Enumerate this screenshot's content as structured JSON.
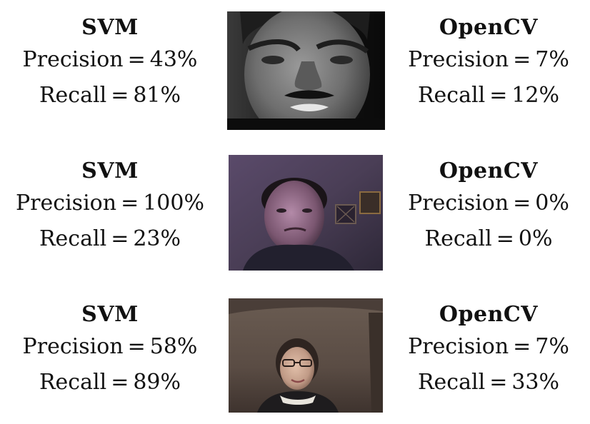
{
  "rows": [
    {
      "svm": {
        "title": "SVM",
        "precision_label": "Precision",
        "precision": "43%",
        "recall_label": "Recall",
        "recall": "81%"
      },
      "opencv": {
        "title": "OpenCV",
        "precision_label": "Precision",
        "precision": "7%",
        "recall_label": "Recall",
        "recall": "12%"
      },
      "image": "grayscale-portrait-man-in-suit"
    },
    {
      "svm": {
        "title": "SVM",
        "precision_label": "Precision",
        "precision": "100%",
        "recall_label": "Recall",
        "recall": "23%"
      },
      "opencv": {
        "title": "OpenCV",
        "precision_label": "Precision",
        "precision": "0%",
        "recall_label": "Recall",
        "recall": "0%"
      },
      "image": "dim-webcam-frame-man-purple-lighting"
    },
    {
      "svm": {
        "title": "SVM",
        "precision_label": "Precision",
        "precision": "58%",
        "recall_label": "Recall",
        "recall": "89%"
      },
      "opencv": {
        "title": "OpenCV",
        "precision_label": "Precision",
        "precision": "7%",
        "recall_label": "Recall",
        "recall": "33%"
      },
      "image": "webcam-frame-woman-glasses-brown-backdrop"
    }
  ],
  "equals_sign": "="
}
